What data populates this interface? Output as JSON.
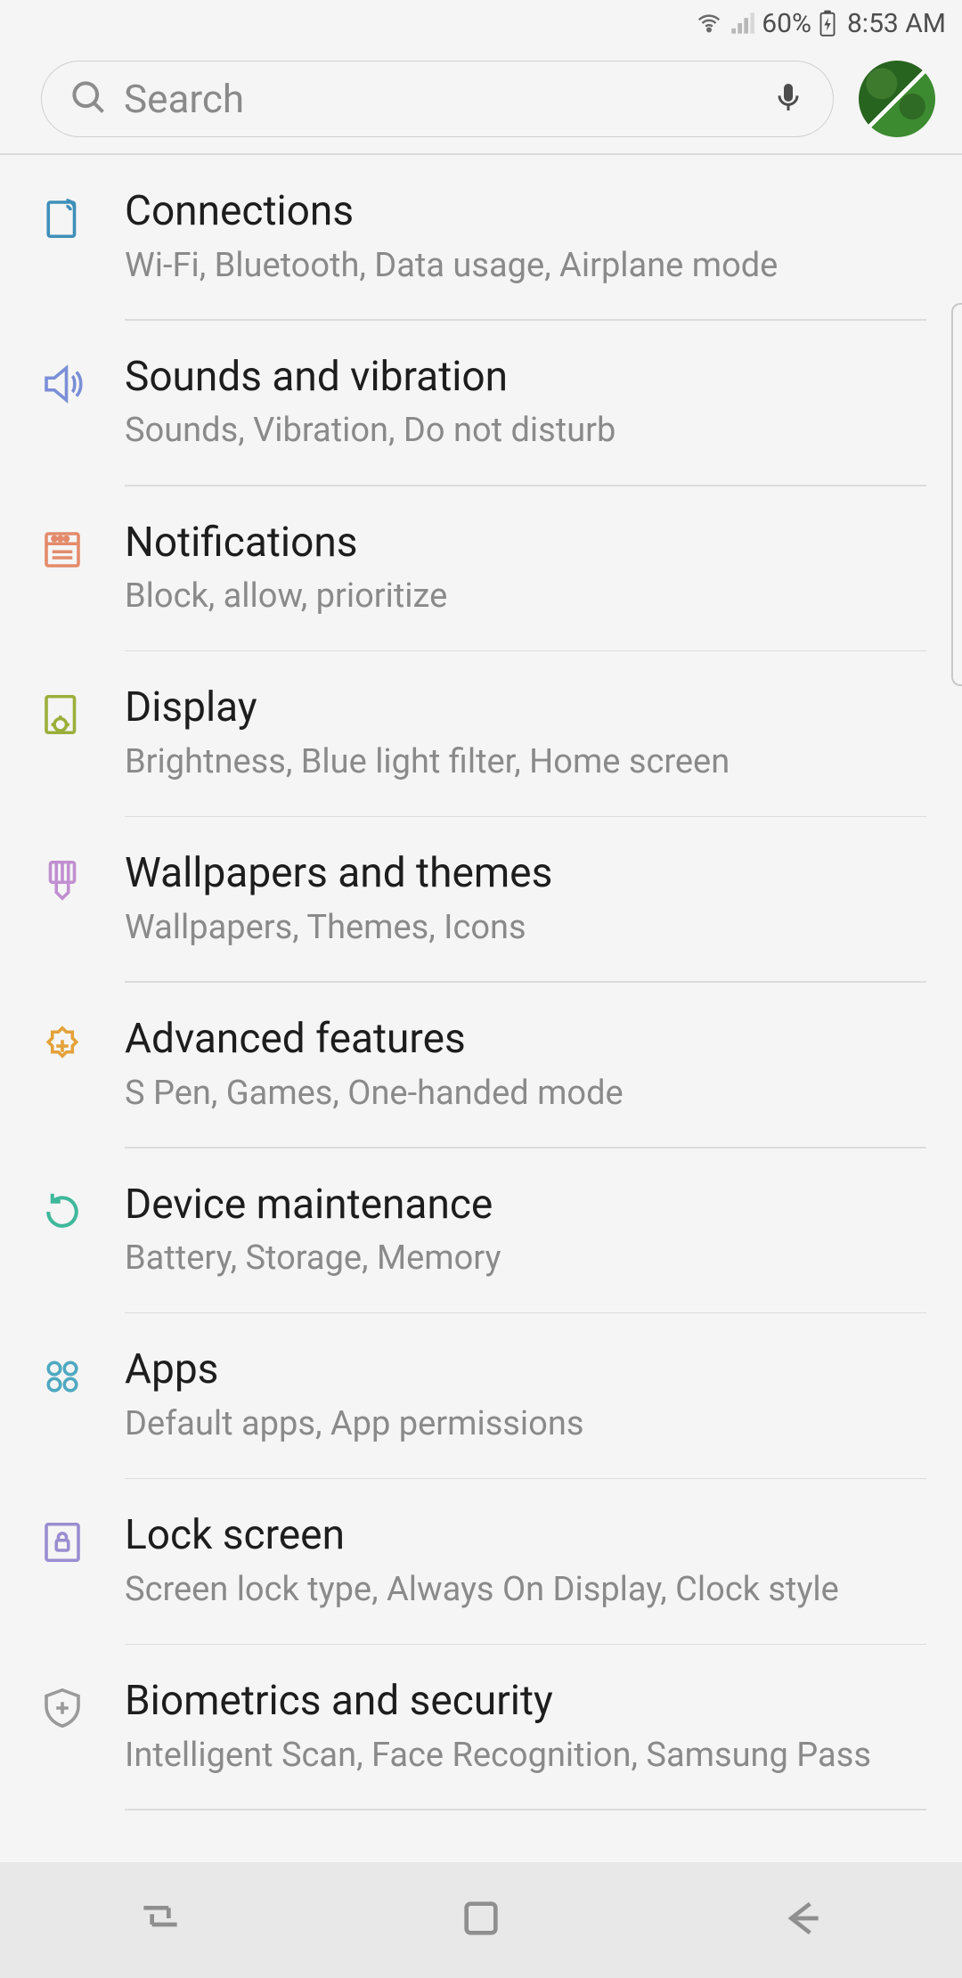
{
  "status": {
    "battery_pct": "60%",
    "time": "8:53 AM"
  },
  "search": {
    "placeholder": "Search"
  },
  "items": [
    {
      "icon": "connections",
      "color": "#3f8fb8",
      "title": "Connections",
      "sub": "Wi-Fi, Bluetooth, Data usage, Airplane mode"
    },
    {
      "icon": "sound",
      "color": "#7a8fd6",
      "title": "Sounds and vibration",
      "sub": "Sounds, Vibration, Do not disturb"
    },
    {
      "icon": "notifications",
      "color": "#e38b6b",
      "title": "Notifications",
      "sub": "Block, allow, prioritize"
    },
    {
      "icon": "display",
      "color": "#9aaf3a",
      "title": "Display",
      "sub": "Brightness, Blue light filter, Home screen"
    },
    {
      "icon": "wallpapers",
      "color": "#c08fd0",
      "title": "Wallpapers and themes",
      "sub": "Wallpapers, Themes, Icons"
    },
    {
      "icon": "advanced",
      "color": "#e3a23a",
      "title": "Advanced features",
      "sub": "S Pen, Games, One-handed mode"
    },
    {
      "icon": "maintenance",
      "color": "#3fb89a",
      "title": "Device maintenance",
      "sub": "Battery, Storage, Memory"
    },
    {
      "icon": "apps",
      "color": "#4fa8c0",
      "title": "Apps",
      "sub": "Default apps, App permissions"
    },
    {
      "icon": "lock",
      "color": "#9a8dd0",
      "title": "Lock screen",
      "sub": "Screen lock type, Always On Display, Clock style"
    },
    {
      "icon": "biometrics",
      "color": "#9a9a9a",
      "title": "Biometrics and security",
      "sub": "Intelligent Scan, Face Recognition, Samsung Pass"
    }
  ]
}
